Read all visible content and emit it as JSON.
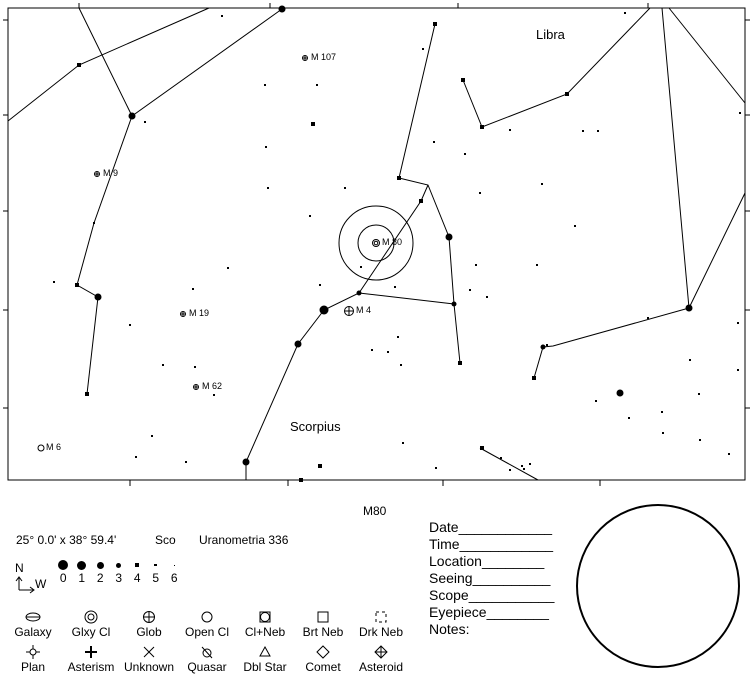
{
  "chart_title": "M80",
  "field_size": "25° 0.0' x 38° 59.4'",
  "constellation_abbr": "Sco",
  "atlas_ref": "Uranometria 336",
  "orientation": {
    "north": "N",
    "west": "W"
  },
  "magnitudes": [
    "0",
    "1",
    "2",
    "3",
    "4",
    "5",
    "6"
  ],
  "constellation_labels": [
    {
      "name": "Libra"
    },
    {
      "name": "Scorpius"
    }
  ],
  "objects": [
    {
      "label": "M 107",
      "type": "glob"
    },
    {
      "label": "M 9",
      "type": "glob"
    },
    {
      "label": "M 80",
      "type": "glxycl"
    },
    {
      "label": "M 4",
      "type": "glob"
    },
    {
      "label": "M 19",
      "type": "glob"
    },
    {
      "label": "M 62",
      "type": "glob"
    },
    {
      "label": "M 6",
      "type": "open"
    }
  ],
  "observation_fields": [
    {
      "label": "Date",
      "line": "____________"
    },
    {
      "label": "Time",
      "line": "____________"
    },
    {
      "label": "Location",
      "line": "________"
    },
    {
      "label": "Seeing",
      "line": "__________"
    },
    {
      "label": "Scope",
      "line": "___________"
    },
    {
      "label": "Eyepiece",
      "line": "________"
    },
    {
      "label": "Notes:",
      "line": ""
    }
  ],
  "legend": {
    "row1": [
      {
        "icon": "galaxy-icon",
        "label": "Galaxy"
      },
      {
        "icon": "galaxy-cluster-icon",
        "label": "Glxy Cl"
      },
      {
        "icon": "globular-cluster-icon",
        "label": "Glob"
      },
      {
        "icon": "open-cluster-icon",
        "label": "Open Cl"
      },
      {
        "icon": "cluster-nebula-icon",
        "label": "Cl+Neb"
      },
      {
        "icon": "bright-nebula-icon",
        "label": "Brt Neb"
      },
      {
        "icon": "dark-nebula-icon",
        "label": "Drk Neb"
      }
    ],
    "row2": [
      {
        "icon": "planet-icon",
        "label": "Plan"
      },
      {
        "icon": "asterism-icon",
        "label": "Asterism"
      },
      {
        "icon": "unknown-icon",
        "label": "Unknown"
      },
      {
        "icon": "quasar-icon",
        "label": "Quasar"
      },
      {
        "icon": "double-star-icon",
        "label": "Dbl Star"
      },
      {
        "icon": "comet-icon",
        "label": "Comet"
      },
      {
        "icon": "asteroid-icon",
        "label": "Asteroid"
      }
    ]
  }
}
